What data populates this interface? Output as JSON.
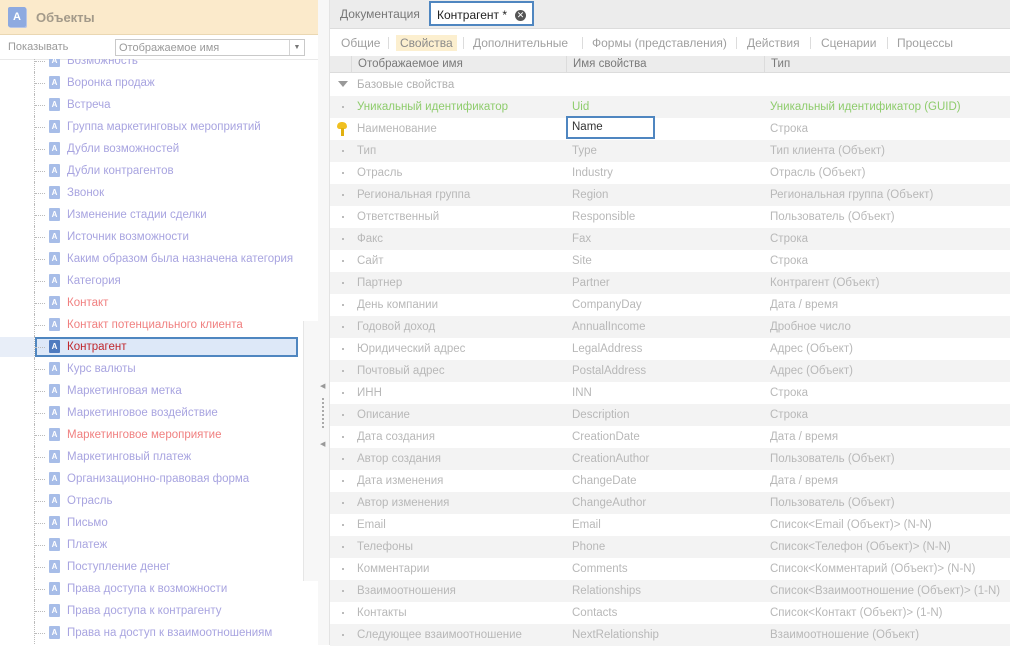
{
  "left_panel": {
    "title": "Объекты",
    "icon_letter": "A",
    "show_label": "Показывать",
    "show_select_value": "Отображаемое имя",
    "tree_items": [
      {
        "label": "Возможность",
        "red": false
      },
      {
        "label": "Воронка продаж",
        "red": false
      },
      {
        "label": "Встреча",
        "red": false
      },
      {
        "label": "Группа маркетинговых мероприятий",
        "red": false
      },
      {
        "label": "Дубли возможностей",
        "red": false
      },
      {
        "label": "Дубли контрагентов",
        "red": false
      },
      {
        "label": "Звонок",
        "red": false
      },
      {
        "label": "Изменение стадии сделки",
        "red": false
      },
      {
        "label": "Источник возможности",
        "red": false
      },
      {
        "label": "Каким образом была назначена категория",
        "red": false
      },
      {
        "label": "Категория",
        "red": false
      },
      {
        "label": "Контакт",
        "red": true
      },
      {
        "label": "Контакт потенциального клиента",
        "red": true
      },
      {
        "label": "Контрагент",
        "red": false,
        "selected": true
      },
      {
        "label": "Курс валюты",
        "red": false
      },
      {
        "label": "Маркетинговая метка",
        "red": false
      },
      {
        "label": "Маркетинговое воздействие",
        "red": false
      },
      {
        "label": "Маркетинговое мероприятие",
        "red": true
      },
      {
        "label": "Маркетинговый платеж",
        "red": false
      },
      {
        "label": "Организационно-правовая форма",
        "red": false
      },
      {
        "label": "Отрасль",
        "red": false
      },
      {
        "label": "Письмо",
        "red": false
      },
      {
        "label": "Платеж",
        "red": false
      },
      {
        "label": "Поступление денег",
        "red": false
      },
      {
        "label": "Права доступа к возможности",
        "red": false
      },
      {
        "label": "Права доступа к контрагенту",
        "red": false
      },
      {
        "label": "Права на доступ к взаимоотношениям",
        "red": false
      }
    ]
  },
  "doc_tabs": [
    {
      "label": "Документация",
      "active": false
    },
    {
      "label": "Контрагент *",
      "active": true
    }
  ],
  "sub_tabs": [
    {
      "label": "Общие",
      "active": false
    },
    {
      "label": "Свойства",
      "active": true
    },
    {
      "label": "Дополнительные",
      "active": false
    },
    {
      "label": "Формы (представления)",
      "active": false
    },
    {
      "label": "Действия",
      "active": false
    },
    {
      "label": "Сценарии",
      "active": false
    },
    {
      "label": "Процессы",
      "active": false
    }
  ],
  "grid": {
    "columns": [
      "Отображаемое имя",
      "Имя свойства",
      "Тип"
    ],
    "group_label": "Базовые свойства",
    "rows": [
      {
        "display": "Уникальный идентификатор",
        "name": "Uid",
        "type": "Уникальный идентификатор (GUID)",
        "highlight": "green"
      },
      {
        "display": "Наименование",
        "name": "Name",
        "type": "Строка",
        "key": true,
        "editing": true
      },
      {
        "display": "Тип",
        "name": "Type",
        "type": "Тип клиента (Объект)"
      },
      {
        "display": "Отрасль",
        "name": "Industry",
        "type": "Отрасль (Объект)"
      },
      {
        "display": "Региональная группа",
        "name": "Region",
        "type": "Региональная группа (Объект)"
      },
      {
        "display": "Ответственный",
        "name": "Responsible",
        "type": "Пользователь (Объект)"
      },
      {
        "display": "Факс",
        "name": "Fax",
        "type": "Строка"
      },
      {
        "display": "Сайт",
        "name": "Site",
        "type": "Строка"
      },
      {
        "display": "Партнер",
        "name": "Partner",
        "type": "Контрагент (Объект)"
      },
      {
        "display": "День компании",
        "name": "CompanyDay",
        "type": "Дата / время"
      },
      {
        "display": "Годовой доход",
        "name": "AnnualIncome",
        "type": "Дробное число"
      },
      {
        "display": "Юридический адрес",
        "name": "LegalAddress",
        "type": "Адрес (Объект)"
      },
      {
        "display": "Почтовый адрес",
        "name": "PostalAddress",
        "type": "Адрес (Объект)"
      },
      {
        "display": "ИНН",
        "name": "INN",
        "type": "Строка"
      },
      {
        "display": "Описание",
        "name": "Description",
        "type": "Строка"
      },
      {
        "display": "Дата создания",
        "name": "CreationDate",
        "type": "Дата / время"
      },
      {
        "display": "Автор создания",
        "name": "CreationAuthor",
        "type": "Пользователь (Объект)"
      },
      {
        "display": "Дата изменения",
        "name": "ChangeDate",
        "type": "Дата / время"
      },
      {
        "display": "Автор изменения",
        "name": "ChangeAuthor",
        "type": "Пользователь (Объект)"
      },
      {
        "display": "Email",
        "name": "Email",
        "type": "Список<Email (Объект)> (N-N)"
      },
      {
        "display": "Телефоны",
        "name": "Phone",
        "type": "Список<Телефон (Объект)> (N-N)"
      },
      {
        "display": "Комментарии",
        "name": "Comments",
        "type": "Список<Комментарий (Объект)> (N-N)"
      },
      {
        "display": "Взаимоотношения",
        "name": "Relationships",
        "type": "Список<Взаимоотношение (Объект)> (1-N)"
      },
      {
        "display": "Контакты",
        "name": "Contacts",
        "type": "Список<Контакт (Объект)> (1-N)"
      },
      {
        "display": "Следующее взаимоотношение",
        "name": "NextRelationship",
        "type": "Взаимоотношение (Объект)"
      }
    ]
  }
}
